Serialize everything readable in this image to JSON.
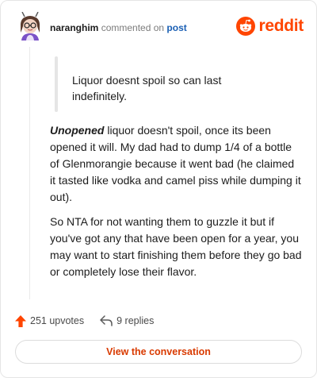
{
  "header": {
    "username": "naranghim",
    "action_text": "commented on",
    "post_link": "post",
    "brand": "reddit"
  },
  "comment": {
    "quote": "Liquor doesnt spoil so can last indefinitely.",
    "p1_emphasis": "Unopened",
    "p1_rest": " liquor doesn't spoil, once its been opened it will. My dad had to dump 1/4 of a bottle of Glenmorangie because it went bad (he claimed it tasted like vodka and camel piss while dumping it out).",
    "p2": "So NTA for not wanting them to guzzle it but if you've got any that have been open for a year, you may want to start finishing them before they go bad or completely lose their flavor."
  },
  "actions": {
    "upvotes": "251 upvotes",
    "replies": "9 replies"
  },
  "cta": {
    "label": "View the conversation"
  },
  "colors": {
    "brand": "#ff4500",
    "link": "#1a5fb4",
    "cta": "#d93a00"
  }
}
